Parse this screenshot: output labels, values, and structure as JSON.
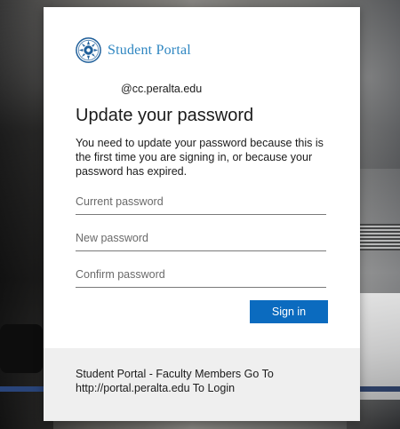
{
  "app": {
    "name": "Student Portal"
  },
  "brand": {
    "logo_icon": "seal-logo-icon",
    "name": "Student Portal",
    "name_color": "#2e86c1"
  },
  "account": {
    "identity": "@cc.peralta.edu"
  },
  "dialog": {
    "title": "Update your password",
    "message": "You need to update your password because this is the first time you are signing in, or because your password has expired.",
    "fields": {
      "current_password": {
        "placeholder": "Current password",
        "value": ""
      },
      "new_password": {
        "placeholder": "New password",
        "value": ""
      },
      "confirm_password": {
        "placeholder": "Confirm password",
        "value": ""
      }
    },
    "primary_button": {
      "label": "Sign in",
      "color": "#0b6bbf"
    }
  },
  "footer": {
    "text": "Student Portal - Faculty Members Go To http://portal.peralta.edu To Login"
  }
}
